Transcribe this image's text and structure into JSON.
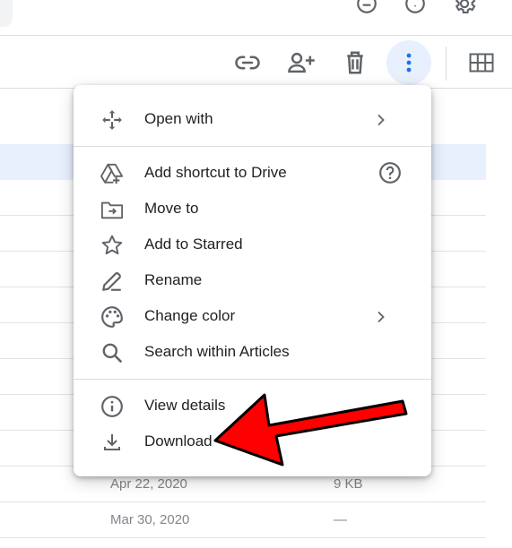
{
  "colors": {
    "accent": "#1a73e8",
    "selected_row": "#e8f0fe",
    "annotation_arrow": "#ff0000"
  },
  "header": {
    "top_icons": [
      "support-icon",
      "help-icon",
      "settings-icon"
    ]
  },
  "toolbar": {
    "icons": [
      "link-icon",
      "share-icon",
      "trash-icon",
      "more-vert-icon",
      "grid-view-icon"
    ]
  },
  "file_list": {
    "rows": [
      {
        "date": "Apr 22, 2020",
        "size": "9 KB"
      },
      {
        "date": "Mar 30, 2020",
        "size": "—"
      }
    ]
  },
  "menu": {
    "open_with": "Open with",
    "add_shortcut": "Add shortcut to Drive",
    "move_to": "Move to",
    "add_starred": "Add to Starred",
    "rename": "Rename",
    "change_color": "Change color",
    "search_within": "Search within Articles",
    "view_details": "View details",
    "download": "Download"
  }
}
